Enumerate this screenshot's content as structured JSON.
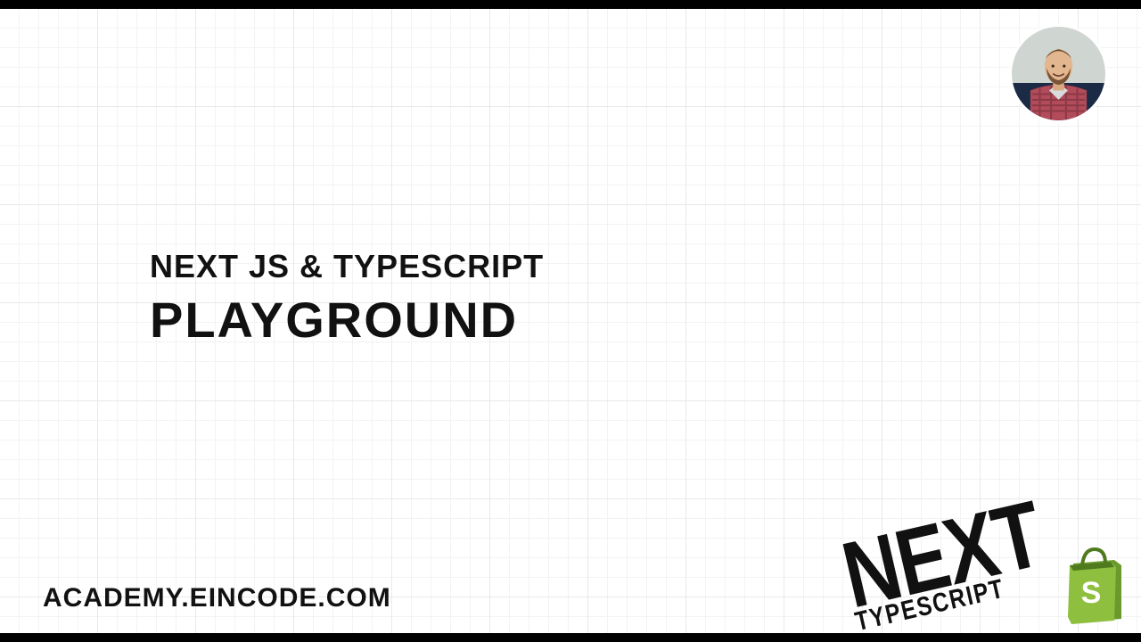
{
  "title": {
    "line1": "NEXT JS & TYPESCRIPT",
    "line2": "PLAYGROUND"
  },
  "site_label": "ACADEMY.EINCODE.COM",
  "brand": {
    "big": "NEXT",
    "sub": "TYPESCRIPT"
  },
  "colors": {
    "text": "#111111",
    "bag_primary": "#8fbf3f",
    "bag_shadow": "#6a9a2b",
    "bag_letter": "#ffffff"
  }
}
